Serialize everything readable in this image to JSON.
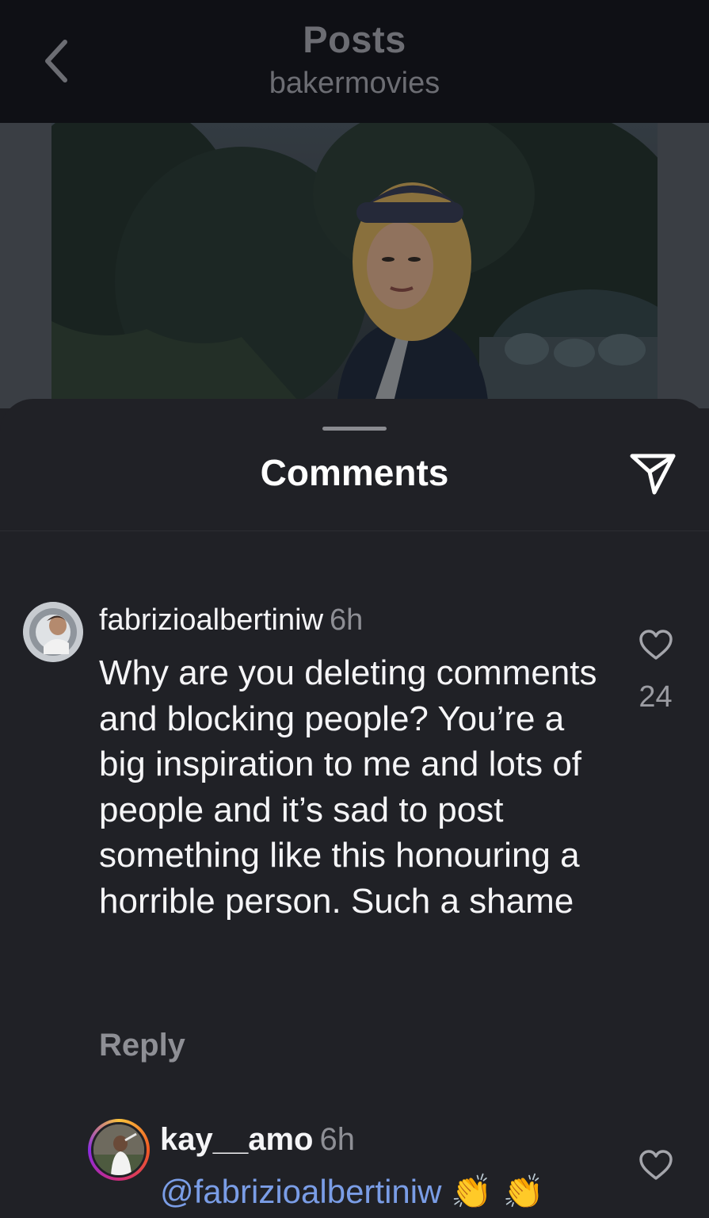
{
  "header": {
    "title": "Posts",
    "subtitle": "bakermovies",
    "back_icon": "chevron-left-icon"
  },
  "post": {
    "image_desc_icon": "photo"
  },
  "sheet": {
    "title": "Comments",
    "share_icon": "paper-plane-icon"
  },
  "comments": [
    {
      "username": "fabrizioalbertiniw",
      "time": "6h",
      "text": "Why are you deleting comments and blocking people? You’re a big inspiration to me and lots of people and it’s sad to post something like this honouring a horrible person. Such a shame",
      "reply_label": "Reply",
      "likes": "24"
    },
    {
      "username": "kay__amo",
      "time": "6h",
      "mention": "@fabrizioalbertiniw",
      "emojis": "👏 👏"
    }
  ],
  "colors": {
    "background": "#202126",
    "header_bg": "#0f1015",
    "mention": "#7a9de6",
    "muted": "#8e8f95"
  }
}
